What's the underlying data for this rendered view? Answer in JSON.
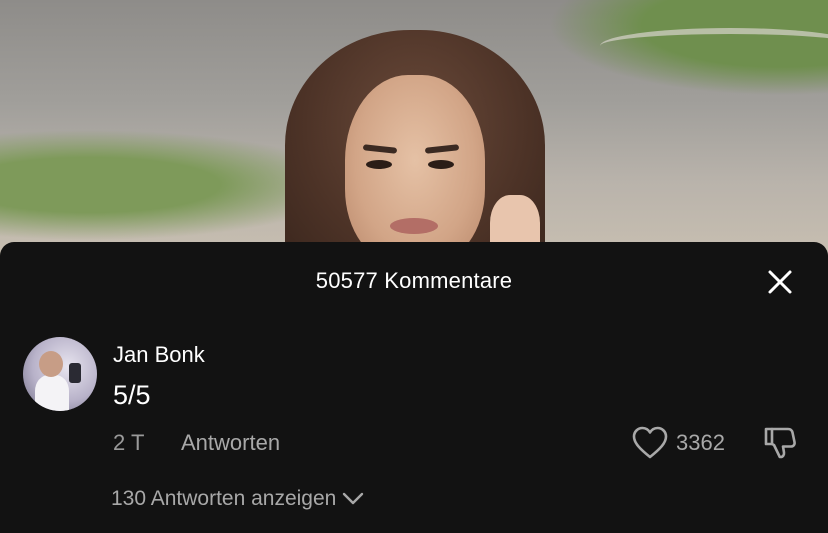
{
  "header": {
    "title": "50577 Kommentare"
  },
  "comment": {
    "username": "Jan Bonk",
    "text": "5/5",
    "time": "2 T",
    "reply_label": "Antworten",
    "like_count": "3362",
    "view_replies_label": "130 Antworten anzeigen"
  },
  "icons": {
    "close": "close-icon",
    "like": "heart-outline-icon",
    "dislike": "thumbs-down-icon",
    "expand": "chevron-down-icon"
  },
  "colors": {
    "sheet_background": "#121212",
    "primary_text": "#ffffff",
    "secondary_text": "#a8a8a8"
  }
}
